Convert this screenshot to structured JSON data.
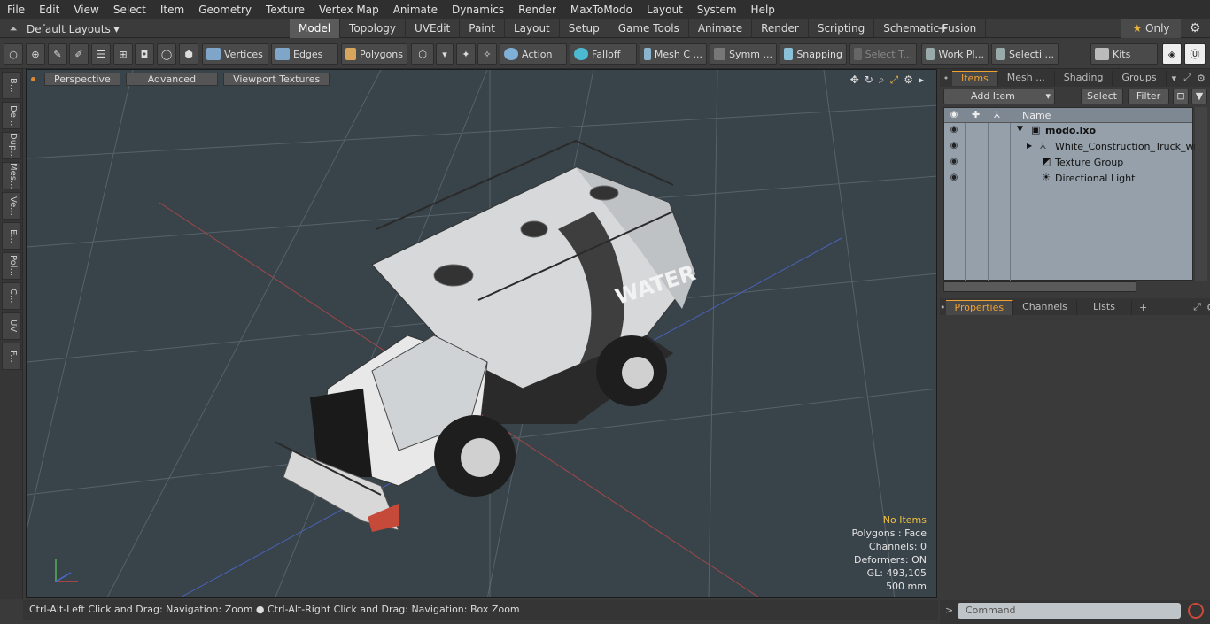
{
  "menu": [
    "File",
    "Edit",
    "View",
    "Select",
    "Item",
    "Geometry",
    "Texture",
    "Vertex Map",
    "Animate",
    "Dynamics",
    "Render",
    "MaxToModo",
    "Layout",
    "System",
    "Help"
  ],
  "layout": {
    "selector": "Default Layouts ▾"
  },
  "tabs": [
    "Model",
    "Topology",
    "UVEdit",
    "Paint",
    "Layout",
    "Setup",
    "Game Tools",
    "Animate",
    "Render",
    "Scripting",
    "Schematic Fusion"
  ],
  "active_tab": "Model",
  "only_label": "Only",
  "toolbar": {
    "vertices": "Vertices",
    "edges": "Edges",
    "polygons": "Polygons",
    "action": "Action",
    "falloff": "Falloff",
    "mesh": "Mesh C ...",
    "symm": "Symm ...",
    "snapping": "Snapping",
    "select_t": "Select T...",
    "work_plane": "Work Pl...",
    "selecti": "Selecti ...",
    "kits": "Kits"
  },
  "sidebar": [
    "B...",
    "De...",
    "Dup...",
    "Mes...",
    "Ve...",
    "E...",
    "Pol...",
    "C...",
    "UV",
    "F..."
  ],
  "viewport": {
    "tabs": [
      "Perspective",
      "Advanced",
      "Viewport Textures"
    ],
    "hud": {
      "no_items": "No Items",
      "polygons": "Polygons : Face",
      "channels": "Channels: 0",
      "deformers": "Deformers: ON",
      "gl": "GL: 493,105",
      "scale": "500 mm"
    },
    "truck_label": "WATER"
  },
  "status": "Ctrl-Alt-Left Click and Drag: Navigation: Zoom ● Ctrl-Alt-Right Click and Drag: Navigation: Box Zoom",
  "items_panel": {
    "tabs": [
      "Items",
      "Mesh ...",
      "Shading",
      "Groups"
    ],
    "add_item": "Add Item",
    "select": "Select",
    "filter": "Filter",
    "name_header": "Name",
    "rows": [
      {
        "label": "modo.lxo"
      },
      {
        "label": "White_Construction_Truck_wi..."
      },
      {
        "label": "Texture Group"
      },
      {
        "label": "Directional Light"
      }
    ]
  },
  "props_panel": {
    "tabs": [
      "Properties",
      "Channels",
      "Lists"
    ]
  },
  "command": {
    "placeholder": "Command"
  }
}
